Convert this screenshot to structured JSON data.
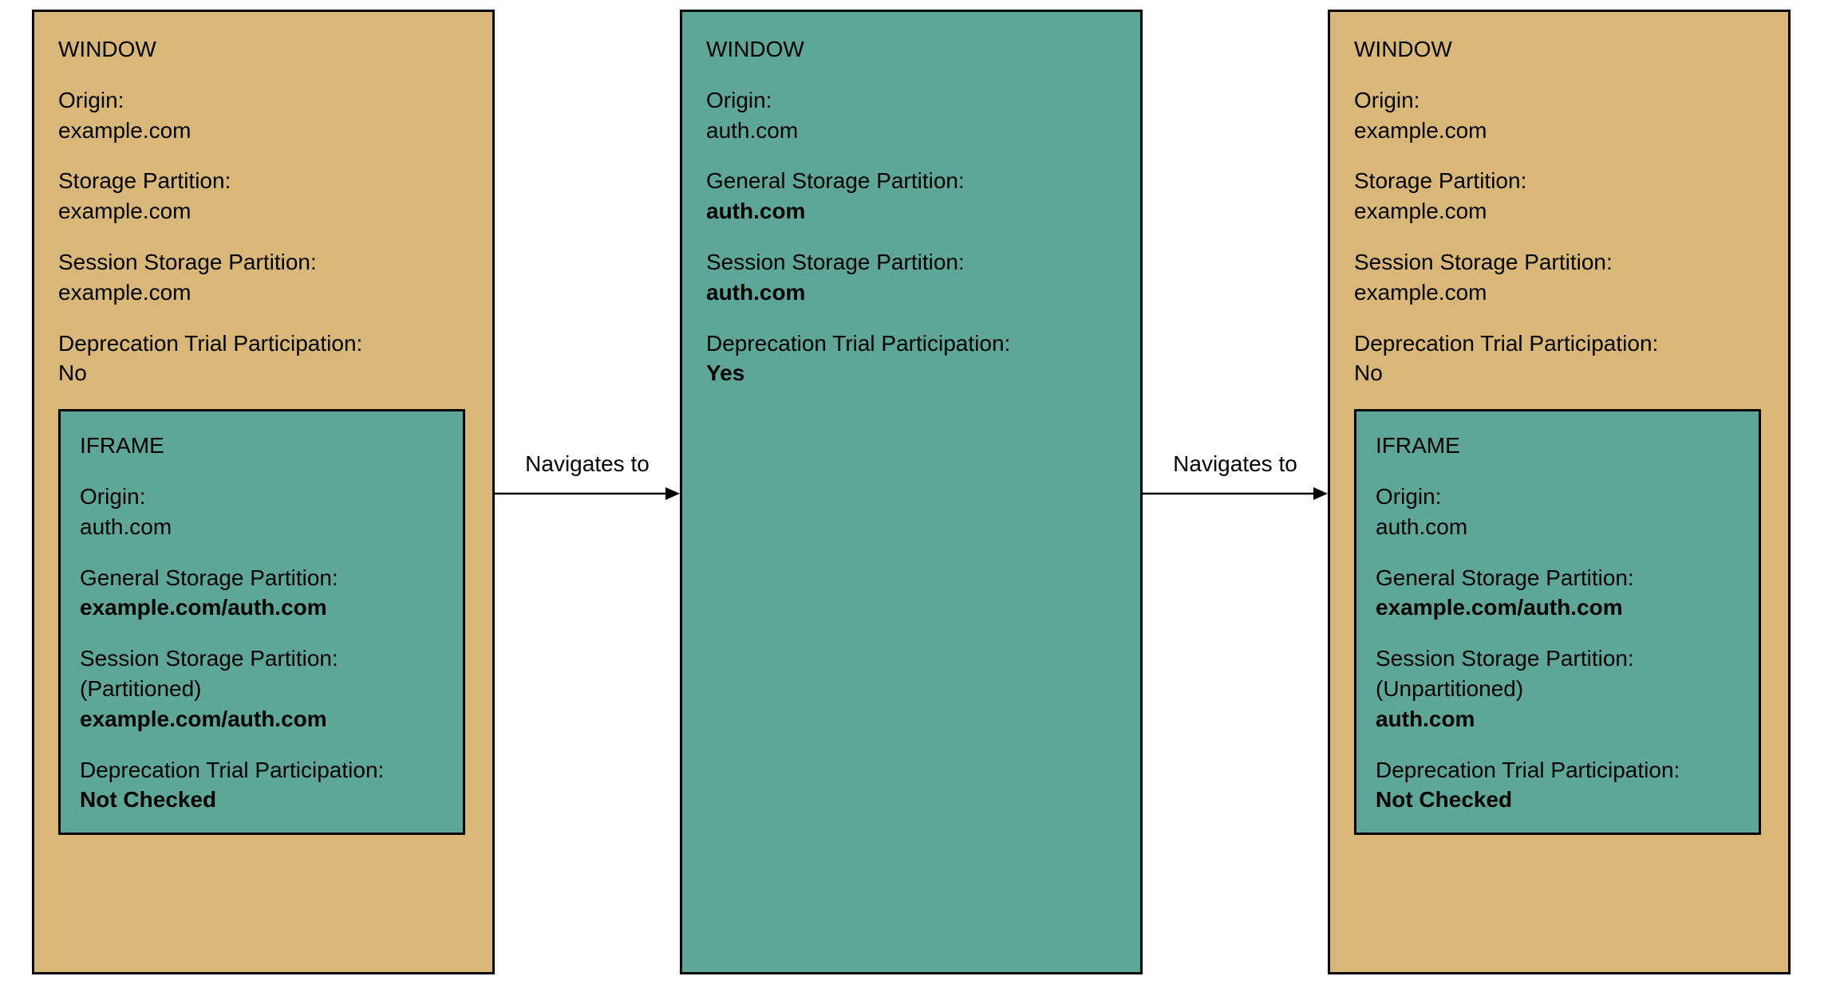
{
  "labels": {
    "window": "WINDOW",
    "iframe": "IFRAME",
    "origin": "Origin:",
    "storage_partition": "Storage Partition:",
    "general_storage_partition": "General Storage Partition:",
    "session_storage_partition": "Session Storage Partition:",
    "deprecation_trial": "Deprecation Trial Participation:"
  },
  "connectors": {
    "c1": "Navigates to",
    "c2": "Navigates to"
  },
  "windows": {
    "w1": {
      "origin": "example.com",
      "storage_partition": "example.com",
      "session_partition_label_extra": "",
      "session_partition": "example.com",
      "deprecation": "No",
      "iframe": {
        "origin": "auth.com",
        "general_partition": "example.com/auth.com",
        "session_partition_note": "(Partitioned)",
        "session_partition": "example.com/auth.com",
        "deprecation": "Not Checked"
      }
    },
    "w2": {
      "origin": "auth.com",
      "general_partition": "auth.com",
      "session_partition": "auth.com",
      "deprecation": "Yes"
    },
    "w3": {
      "origin": "example.com",
      "storage_partition": "example.com",
      "session_partition": "example.com",
      "deprecation": "No",
      "iframe": {
        "origin": "auth.com",
        "general_partition": "example.com/auth.com",
        "session_partition_note": "(Unpartitioned)",
        "session_partition": "auth.com",
        "deprecation": "Not Checked"
      }
    }
  }
}
